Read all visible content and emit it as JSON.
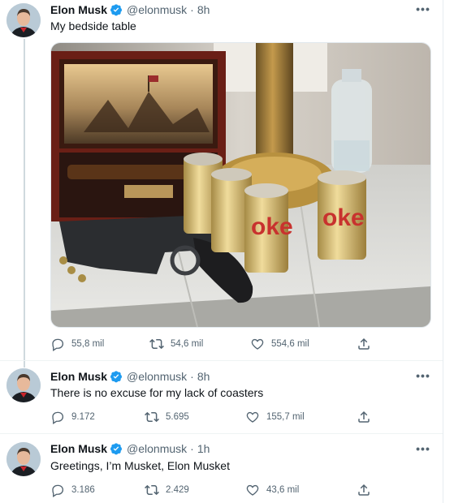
{
  "tweets": [
    {
      "name": "Elon Musk",
      "handle": "@elonmusk",
      "dot": "·",
      "time": "8h",
      "text": "My bedside table",
      "image_text": "oke",
      "replies": "55,8 mil",
      "retweets": "54,6 mil",
      "likes": "554,6 mil"
    },
    {
      "name": "Elon Musk",
      "handle": "@elonmusk",
      "dot": "·",
      "time": "8h",
      "text": "There is no excuse for my lack of coasters",
      "replies": "9.172",
      "retweets": "5.695",
      "likes": "155,7 mil"
    },
    {
      "name": "Elon Musk",
      "handle": "@elonmusk",
      "dot": "·",
      "time": "1h",
      "text": "Greetings, I’m Musket, Elon Musket",
      "replies": "3.186",
      "retweets": "2.429",
      "likes": "43,6 mil"
    }
  ],
  "ui": {
    "more_glyph": "•••",
    "accent_color": "#1d9bf0",
    "icons": [
      "reply-icon",
      "retweet-icon",
      "like-icon",
      "share-icon",
      "verified-badge-icon",
      "more-options-icon"
    ]
  }
}
